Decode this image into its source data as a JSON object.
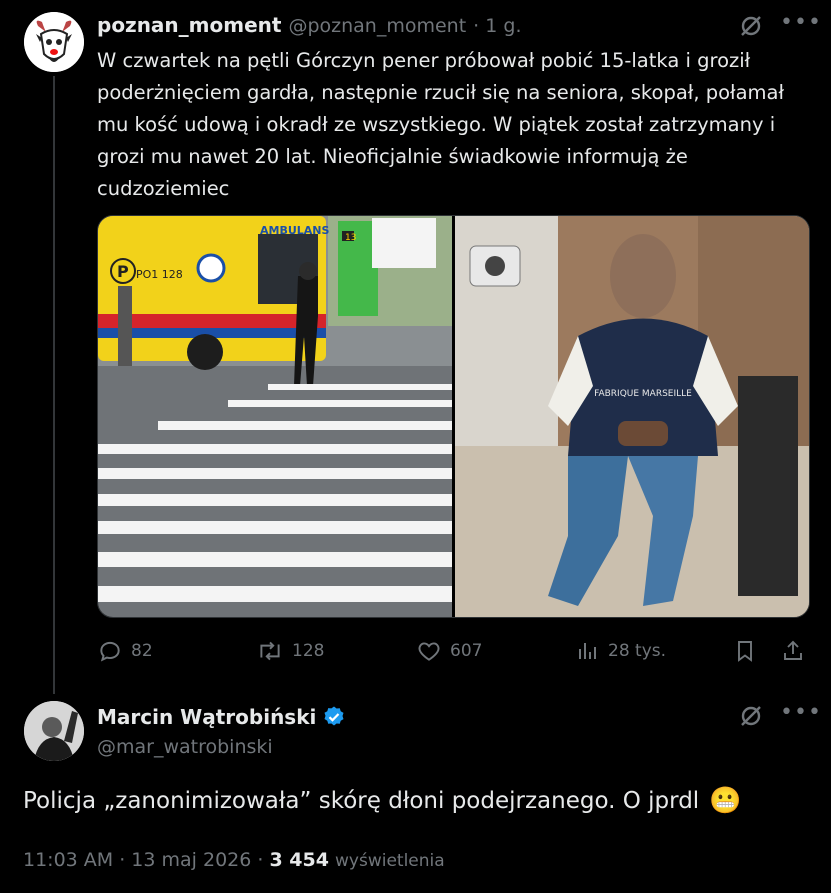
{
  "tweet1": {
    "display_name": "poznan_moment",
    "handle": "@poznan_moment",
    "time": "· 1 g.",
    "text": "W czwartek na pętli Górczyn pener próbował pobić 15-latka i groził poderżnięciem gardła, następnie rzucił się na seniora, skopał, połamał mu kość udową i okradł ze wszystkiego. W piątek został zatrzymany i grozi mu nawet 20 lat. Nieoficjalnie świadkowie informują że cudzoziemiec",
    "image_left": {
      "ambulance_label": "AMBULANS",
      "ambulance_code": "PO1 128",
      "bus_number": "13"
    },
    "image_right": {
      "jacket_text": "FABRIQUE MARSEILLE"
    },
    "stats": {
      "replies": "82",
      "reposts": "128",
      "likes": "607",
      "views": "28 tys."
    }
  },
  "tweet2": {
    "display_name": "Marcin Wątrobiński",
    "handle": "@mar_watrobinski",
    "text": "Policja „zanonimizowała” skórę dłoni podejrzanego. O jprdl",
    "emoji": "😬",
    "time": "11:03 AM · 13 maj 2026 · ",
    "views_count": "3 454",
    "views_label": "wyświetlenia"
  },
  "colors": {
    "background": "#000000",
    "text": "#e7e9ea",
    "muted": "#71767b",
    "verified": "#1d9bf0"
  }
}
